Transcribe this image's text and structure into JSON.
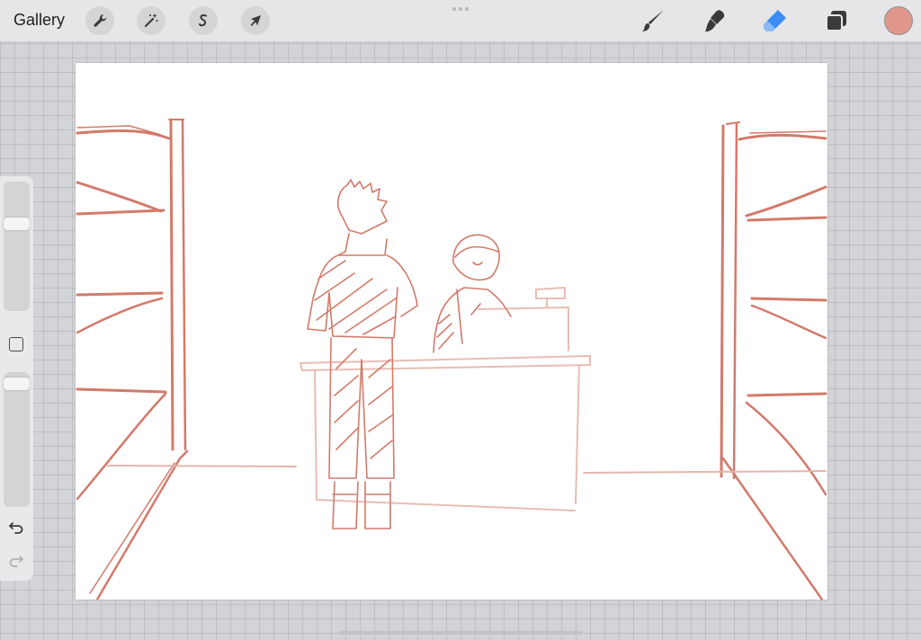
{
  "topbar": {
    "gallery_label": "Gallery",
    "left_tools": [
      {
        "icon": "wrench-icon",
        "name": "actions"
      },
      {
        "icon": "magic-wand-icon",
        "name": "adjustments"
      },
      {
        "icon": "selection-icon",
        "name": "selection"
      },
      {
        "icon": "arrow-cursor-icon",
        "name": "transform"
      }
    ],
    "right_tools": [
      {
        "icon": "brush-icon",
        "name": "paint"
      },
      {
        "icon": "smudge-icon",
        "name": "smudge"
      },
      {
        "icon": "eraser-icon",
        "name": "erase"
      },
      {
        "icon": "layers-icon",
        "name": "layers"
      }
    ],
    "active_tool": "erase",
    "current_color": "#e0968a",
    "accent_color": "#3d8df5"
  },
  "sidebar": {
    "brush_size_level": 0.2,
    "opacity_level": 0.05,
    "modify_icon": "square-icon",
    "undo_icon": "undo-icon",
    "redo_icon": "redo-icon"
  },
  "canvas": {
    "background": "#ffffff",
    "stroke_color": "#d27a6b",
    "subject": "sketch-convenience-store-counter"
  }
}
